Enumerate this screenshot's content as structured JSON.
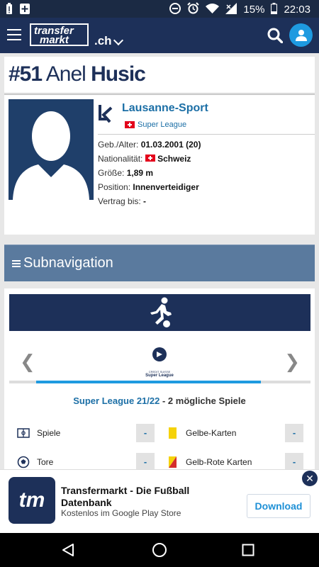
{
  "status_bar": {
    "battery_percent": "15%",
    "time": "22:03",
    "icons": [
      "battery-saver-icon",
      "plus-icon",
      "minus-circle-icon",
      "alarm-icon",
      "wifi-icon",
      "signal-icon",
      "battery-icon"
    ]
  },
  "header": {
    "logo_line1": "transfer",
    "logo_line2": "markt",
    "tld": ".ch",
    "icons": [
      "hamburger-menu-icon",
      "chevron-down-icon",
      "search-icon",
      "user-icon"
    ]
  },
  "player": {
    "number": "#51",
    "first_name": "Anel",
    "last_name": "Husic"
  },
  "profile": {
    "club": "Lausanne-Sport",
    "league": "Super League",
    "facts": [
      {
        "label": "Geb./Alter:",
        "value": "01.03.2001 (20)"
      },
      {
        "label": "Nationalität:",
        "value": "Schweiz"
      },
      {
        "label": "Größe:",
        "value": "1,89 m"
      },
      {
        "label": "Position:",
        "value": "Innenverteidiger"
      },
      {
        "label": "Vertrag bis:",
        "value": "-"
      }
    ]
  },
  "subnav": {
    "icon": "menu-lines-icon",
    "label": "Subnavigation"
  },
  "stats": {
    "banner_icon": "football-player-icon",
    "league_logo_line1": "CREDIT SUISSE",
    "league_logo_line2": "Super League",
    "prev_arrow": "❮",
    "next_arrow": "❯",
    "progress": 0.82,
    "season_link": "Super League 21/22",
    "season_suffix": " - 2 mögliche Spiele",
    "items": [
      {
        "label": "Spiele",
        "value": "-",
        "icon": "pitch-icon"
      },
      {
        "label": "Gelbe-Karten",
        "value": "-",
        "icon": "yellow-card-icon"
      },
      {
        "label": "Tore",
        "value": "-",
        "icon": "ball-icon"
      },
      {
        "label": "Gelb-Rote Karten",
        "value": "-",
        "icon": "yellow-red-card-icon"
      }
    ]
  },
  "ad": {
    "icon_text": "tm",
    "title": "Transfermarkt - Die Fußball Datenbank",
    "subtitle": "Kostenlos im Google Play Store",
    "button": "Download",
    "close": "✕"
  },
  "navbar": {
    "icons": [
      "back-icon",
      "home-icon",
      "recents-icon"
    ]
  },
  "colors": {
    "brand_navy": "#1d3059",
    "accent_blue": "#1e9ae0",
    "link_blue": "#1c6fa6",
    "subnav": "#5a7a9e"
  }
}
